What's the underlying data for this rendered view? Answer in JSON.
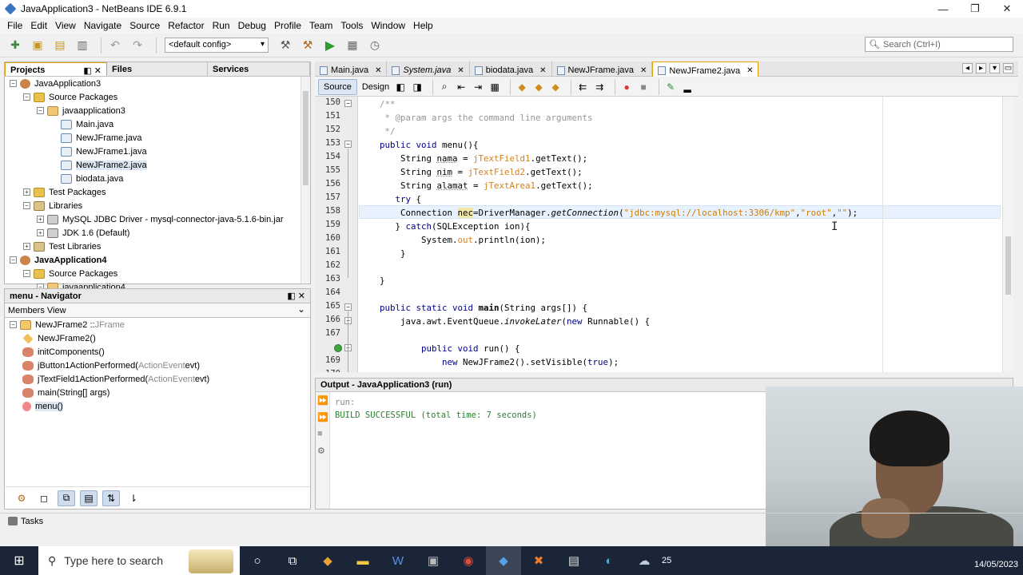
{
  "window": {
    "title": "JavaApplication3 - NetBeans IDE 6.9.1",
    "minimize": "—",
    "maximize": "❐",
    "close": "✕"
  },
  "menu": [
    "File",
    "Edit",
    "View",
    "Navigate",
    "Source",
    "Refactor",
    "Run",
    "Debug",
    "Profile",
    "Team",
    "Tools",
    "Window",
    "Help"
  ],
  "toolbar": {
    "config": "<default config>",
    "search_placeholder": "Search (Ctrl+I)"
  },
  "projects": {
    "tabs": [
      "Projects",
      "Files",
      "Services"
    ],
    "rows": [
      {
        "label": "JavaApplication3",
        "indent": 0,
        "icon": "proj",
        "tog": "−"
      },
      {
        "label": "Source Packages",
        "indent": 1,
        "icon": "folder",
        "tog": "−"
      },
      {
        "label": "javaapplication3",
        "indent": 2,
        "icon": "pkg",
        "tog": "−"
      },
      {
        "label": "Main.java",
        "indent": 3,
        "icon": "java",
        "tog": ""
      },
      {
        "label": "NewJFrame.java",
        "indent": 3,
        "icon": "java",
        "tog": ""
      },
      {
        "label": "NewJFrame1.java",
        "indent": 3,
        "icon": "java",
        "tog": ""
      },
      {
        "label": "NewJFrame2.java",
        "indent": 3,
        "icon": "java",
        "tog": "",
        "selected": true
      },
      {
        "label": "biodata.java",
        "indent": 3,
        "icon": "java",
        "tog": ""
      },
      {
        "label": "Test Packages",
        "indent": 1,
        "icon": "folder",
        "tog": "+"
      },
      {
        "label": "Libraries",
        "indent": 1,
        "icon": "lib",
        "tog": "−"
      },
      {
        "label": "MySQL JDBC Driver - mysql-connector-java-5.1.6-bin.jar",
        "indent": 2,
        "icon": "jar",
        "tog": "+"
      },
      {
        "label": "JDK 1.6 (Default)",
        "indent": 2,
        "icon": "jar",
        "tog": "+"
      },
      {
        "label": "Test Libraries",
        "indent": 1,
        "icon": "lib",
        "tog": "+"
      },
      {
        "label": "JavaApplication4",
        "indent": 0,
        "icon": "proj",
        "tog": "−",
        "bold": true
      },
      {
        "label": "Source Packages",
        "indent": 1,
        "icon": "folder",
        "tog": "−"
      },
      {
        "label": "javaapplication4",
        "indent": 2,
        "icon": "pkg",
        "tog": "−"
      }
    ]
  },
  "navigator": {
    "title": "menu - Navigator",
    "view": "Members View",
    "rows": [
      {
        "name": "NewJFrame2 :: ",
        "type": "JFrame",
        "indent": 0,
        "tog": "−"
      },
      {
        "name": "NewJFrame2()",
        "indent": 1
      },
      {
        "name": "initComponents()",
        "indent": 1
      },
      {
        "name": "jButton1ActionPerformed(",
        "param": "ActionEvent",
        "tail": " evt)",
        "indent": 1
      },
      {
        "name": "jTextField1ActionPerformed(",
        "param": "ActionEvent",
        "tail": " evt)",
        "indent": 1
      },
      {
        "name": "main(String[] args)",
        "indent": 1
      },
      {
        "name": "menu()",
        "indent": 1,
        "selected": true
      }
    ]
  },
  "editor": {
    "tabs": [
      "Main.java",
      "System.java",
      "biodata.java",
      "NewJFrame.java",
      "NewJFrame2.java"
    ],
    "active_tab": "NewJFrame2.java",
    "source_label": "Source",
    "design_label": "Design",
    "lines": [
      {
        "n": "150",
        "t": "    /**",
        "c": "cm",
        "fold": "−"
      },
      {
        "n": "151",
        "t": "     * @param args the command line arguments",
        "c": "cm"
      },
      {
        "n": "152",
        "t": "     */",
        "c": "cm"
      },
      {
        "n": "153",
        "fold": "−",
        "parts": [
          [
            "    ",
            ""
          ],
          [
            "public void ",
            "kw"
          ],
          [
            "menu(){",
            ""
          ]
        ]
      },
      {
        "n": "154",
        "parts": [
          [
            "        String ",
            ""
          ],
          [
            "nama",
            ""
          ],
          [
            " = ",
            ""
          ],
          [
            "jTextField1",
            ""
          ],
          [
            ".getText();",
            ""
          ]
        ]
      },
      {
        "n": "155",
        "parts": [
          [
            "        String ",
            ""
          ],
          [
            "nim",
            ""
          ],
          [
            " = ",
            ""
          ],
          [
            "jTextField2",
            ""
          ],
          [
            ".getText();",
            ""
          ]
        ]
      },
      {
        "n": "156",
        "parts": [
          [
            "        String ",
            ""
          ],
          [
            "alamat",
            ""
          ],
          [
            " = ",
            ""
          ],
          [
            "jTextArea1",
            ""
          ],
          [
            ".getText();",
            ""
          ]
        ]
      },
      {
        "n": "157",
        "parts": [
          [
            "       ",
            ""
          ],
          [
            "try",
            ""
          ],
          [
            " {",
            ""
          ]
        ]
      },
      {
        "n": "158",
        "hl": true,
        "parts": [
          [
            "        Connection ",
            ""
          ],
          [
            "nec",
            ""
          ],
          [
            "=DriverManager.",
            ""
          ],
          [
            "getConnection",
            ""
          ],
          [
            "(",
            ""
          ],
          [
            "\"jdbc:mysql://localhost:3306/kmp\"",
            ""
          ],
          [
            ",",
            ""
          ],
          [
            "\"root\"",
            ""
          ],
          [
            ",",
            ""
          ],
          [
            "\"\"",
            ""
          ],
          [
            ");",
            ""
          ]
        ]
      },
      {
        "n": "159",
        "parts": [
          [
            "       } ",
            ""
          ],
          [
            "catch",
            ""
          ],
          [
            "(SQLException ion){",
            ""
          ]
        ]
      },
      {
        "n": "160",
        "parts": [
          [
            "            System.",
            ""
          ],
          [
            "out",
            ""
          ],
          [
            ".println(ion);",
            ""
          ]
        ]
      },
      {
        "n": "161",
        "parts": [
          [
            "        }",
            ""
          ]
        ]
      },
      {
        "n": "162",
        "parts": [
          [
            "",
            ""
          ]
        ]
      },
      {
        "n": "163",
        "parts": [
          [
            "    }",
            ""
          ]
        ]
      },
      {
        "n": "164",
        "parts": [
          [
            "",
            ""
          ]
        ]
      },
      {
        "n": "165",
        "fold": "−",
        "parts": [
          [
            "    ",
            ""
          ],
          [
            "public static void ",
            ""
          ],
          [
            "main",
            ""
          ],
          [
            "(String args[]) {",
            ""
          ]
        ]
      },
      {
        "n": "166",
        "fold": "−",
        "parts": [
          [
            "        java.awt.EventQueue.",
            ""
          ],
          [
            "invokeLater",
            ""
          ],
          [
            "(",
            ""
          ],
          [
            "new ",
            ""
          ],
          [
            "Runnable() {",
            ""
          ]
        ]
      },
      {
        "n": "167",
        "parts": [
          [
            "",
            ""
          ]
        ]
      },
      {
        "n": "",
        "fold": "−",
        "parts": [
          [
            "            ",
            ""
          ],
          [
            "public void ",
            ""
          ],
          [
            "run() {",
            ""
          ]
        ]
      },
      {
        "n": "169",
        "parts": [
          [
            "                ",
            ""
          ],
          [
            "new ",
            ""
          ],
          [
            "NewJFrame2().setVisible(",
            ""
          ],
          [
            "true",
            ""
          ],
          [
            ");",
            ""
          ]
        ]
      },
      {
        "n": "170",
        "parts": [
          [
            "            }",
            ""
          ]
        ]
      }
    ]
  },
  "output": {
    "title": "Output - JavaApplication3 (run)",
    "lines": [
      "run:",
      "BUILD SUCCESSFUL (total time: 7 seconds)"
    ]
  },
  "tasks_label": "Tasks",
  "taskbar": {
    "search_placeholder": "Type here to search",
    "temp": "25",
    "date": "14/05/2023"
  },
  "colors": {
    "keyword": "#00008b",
    "comment": "#969696",
    "field": "#d4801f",
    "string": "#ce7b00",
    "highlight": "#e8f2fe"
  }
}
